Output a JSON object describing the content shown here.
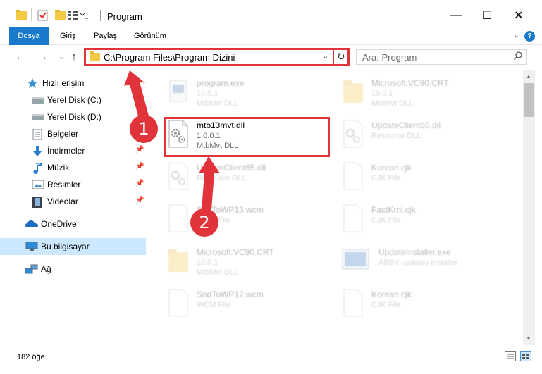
{
  "window": {
    "title": "Program",
    "minimize_glyph": "—",
    "maximize_glyph": "☐",
    "close_glyph": "✕"
  },
  "ribbon": {
    "tabs": [
      {
        "label": "Dosya",
        "active": true
      },
      {
        "label": "Giriş"
      },
      {
        "label": "Paylaş"
      },
      {
        "label": "Görünüm"
      }
    ],
    "help_label": "?"
  },
  "nav": {
    "back": "←",
    "forward": "→",
    "recent": "⌄",
    "up": "↑",
    "address": "C:\\Program Files\\Program Dizini",
    "refresh": "↻",
    "search_placeholder": "Ara: Program"
  },
  "sidebar": {
    "items": [
      {
        "label": "Hızlı erişim",
        "icon": "star-icon"
      },
      {
        "label": "Yerel Disk (C:)",
        "icon": "drive-icon"
      },
      {
        "label": "Yerel Disk (D:)",
        "icon": "drive-icon"
      },
      {
        "label": "Belgeler",
        "icon": "documents-icon"
      },
      {
        "label": "İndirmeler",
        "icon": "download-icon",
        "pinned": true
      },
      {
        "label": "Müzik",
        "icon": "music-icon",
        "pinned": true
      },
      {
        "label": "Resimler",
        "icon": "pictures-icon",
        "pinned": true
      },
      {
        "label": "Videolar",
        "icon": "videos-icon",
        "pinned": true
      },
      {
        "label": "OneDrive",
        "icon": "onedrive-icon"
      },
      {
        "label": "Bu bilgisayar",
        "icon": "computer-icon",
        "selected": true
      },
      {
        "label": "Ağ",
        "icon": "network-icon"
      }
    ],
    "pin_glyph": "📌"
  },
  "files": [
    {
      "name": "program.exe",
      "sub1": "10.0.1",
      "sub2": "MtbMvt DLL",
      "icon": "exe-icon",
      "col": 0,
      "blurred": true
    },
    {
      "name": "Microsoft.VC90.CRT",
      "sub1": "10.0.1",
      "sub2": "MtbMvt DLL",
      "icon": "folder-icon",
      "col": 1,
      "blurred": true
    },
    {
      "name": "mtb13mvt.dll",
      "sub1": "1.0.0.1",
      "sub2": "MtbMvt DLL",
      "icon": "dll-icon",
      "col": 0,
      "blurred": false
    },
    {
      "name": "UpdateClient65.dll",
      "sub1": "Resource DLL",
      "sub2": "",
      "icon": "dll-icon",
      "col": 1,
      "blurred": true
    },
    {
      "name": "UpdateClient65.dll",
      "sub1": "Resource DLL",
      "sub2": "",
      "icon": "dll-icon",
      "col": 0,
      "blurred": true
    },
    {
      "name": "Korean.cjk",
      "sub1": "CJK File",
      "sub2": "",
      "icon": "file-icon",
      "col": 1,
      "blurred": true
    },
    {
      "name": "SndToWP13.wcm",
      "sub1": "WCM File",
      "sub2": "",
      "icon": "file-icon",
      "col": 0,
      "blurred": true
    },
    {
      "name": "FastKrnl.cjk",
      "sub1": "CJK File",
      "sub2": "",
      "icon": "file-icon",
      "col": 1,
      "blurred": true
    },
    {
      "name": "Microsoft.VC90.CRT",
      "sub1": "10.0.1",
      "sub2": "MtbMvt DLL",
      "icon": "folder-icon",
      "col": 0,
      "blurred": true
    },
    {
      "name": "UpdateInstaller.exe",
      "sub1": "ABBY updates installer",
      "sub2": "",
      "icon": "installer-icon",
      "col": 1,
      "blurred": true
    },
    {
      "name": "SndToWP12.wcm",
      "sub1": "WCM File",
      "sub2": "",
      "icon": "file-icon",
      "col": 0,
      "blurred": true
    },
    {
      "name": "Korean.cjk",
      "sub1": "CJK File",
      "sub2": "",
      "icon": "file-icon",
      "col": 1,
      "blurred": true
    }
  ],
  "status": {
    "item_count": "182 öğe"
  },
  "callouts": {
    "step1": "1",
    "step2": "2"
  },
  "colors": {
    "accent": "#1979ca",
    "highlight": "#e0343a",
    "selected_bg": "#cce8ff"
  }
}
